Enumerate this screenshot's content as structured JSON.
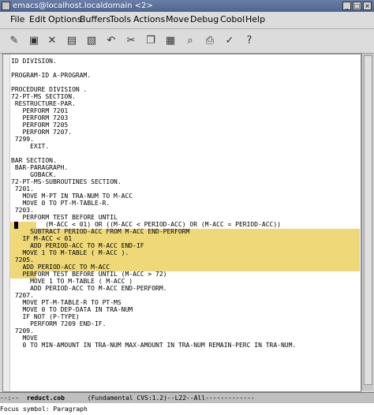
{
  "window": {
    "title": "emacs@localhost.localdomain <2>"
  },
  "menu": [
    "File",
    "Edit",
    "Options",
    "Buffers",
    "Tools",
    "Actions",
    "Move",
    "Debug",
    "Cobol",
    "Help"
  ],
  "toolbar_icons": [
    "open-file-icon",
    "open-dir-icon",
    "close-icon",
    "save-icon",
    "save-as-icon",
    "undo-icon",
    "cut-icon",
    "copy-icon",
    "paste-icon",
    "search-icon",
    "print-icon",
    "customize-icon",
    "help-icon"
  ],
  "code": [
    "ID DIVISION.",
    "",
    "PROGRAM-ID A-PROGRAM.",
    "",
    "PROCEDURE DIVISION .",
    "72-PT-MS SECTION.",
    " RESTRUCTURE-PAR.",
    "   PERFORM 7201",
    "   PERFORM 7203",
    "   PERFORM 7205",
    "   PERFORM 7207.",
    " 7299.",
    "     EXIT.",
    "",
    "BAR SECTION.",
    " BAR-PARAGRAPH.",
    "     GOBACK.",
    "72-PT-MS-SUBROUTINES SECTION.",
    " 7201.",
    "   MOVE M-PT IN TRA-NUM TO M-ACC",
    "   MOVE 0 TO PT-M-TABLE-R.",
    " 7203.",
    "   PERFORM TEST BEFORE UNTIL",
    "         (M-ACC < 01) OR ((M-ACC < PERIOD-ACC) OR (M-ACC = PERIOD-ACC))",
    "     SUBTRACT PERIOD-ACC FROM M-ACC END-PERFORM",
    "   IF M-ACC < 01",
    "     ADD PERIOD-ACC TO M-ACC END-IF",
    "   MOVE 1 TO M-TABLE ( M-ACC ).",
    " 7205.",
    "   ADD PERIOD-ACC TO M-ACC",
    "   PERFORM TEST BEFORE UNTIL (M-ACC > 72)",
    "     MOVE 1 TO M-TABLE ( M-ACC )",
    "     ADD PERIOD-ACC TO M-ACC END-PERFORM.",
    " 7207.",
    "   MOVE PT-M-TABLE-R TO PT-MS",
    "   MOVE 0 TO DEP-DATA IN TRA-NUM",
    "   IF NOT (P-TYPE)",
    "     PERFORM 7209 END-IF.",
    " 7209.",
    "   MOVE",
    "   0 TO MIN-AMOUNT IN TRA-NUM MAX-AMOUNT IN TRA-NUM REMAIN-PERC IN TRA-NUM."
  ],
  "modeline": {
    "prefix": "--:--  ",
    "buffer": "reduct.cob",
    "info": "      (Fundamental CVS:1.2)--L22--All-------------"
  },
  "minibuffer": "Focus symbol: Paragraph"
}
